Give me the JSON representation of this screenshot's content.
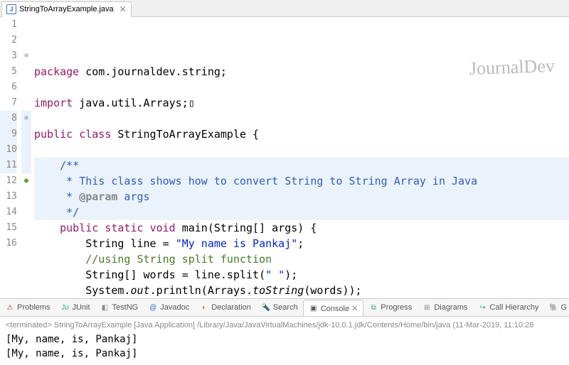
{
  "tab": {
    "filename": "StringToArrayExample.java",
    "icon_letter": "J"
  },
  "watermark": "JournalDev",
  "code": {
    "lines": [
      {
        "n": "1",
        "marker": "",
        "tokens": [
          [
            "kw",
            "package"
          ],
          [
            "plain",
            " com.journaldev.string;"
          ]
        ]
      },
      {
        "n": "2",
        "marker": "",
        "tokens": []
      },
      {
        "n": "3",
        "marker": "fold",
        "tokens": [
          [
            "kw",
            "import"
          ],
          [
            "plain",
            " java.util.Arrays;"
          ],
          [
            "plain",
            "▯"
          ]
        ]
      },
      {
        "n": "5",
        "marker": "",
        "tokens": []
      },
      {
        "n": "6",
        "marker": "",
        "tokens": [
          [
            "kw",
            "public"
          ],
          [
            "plain",
            " "
          ],
          [
            "kw",
            "class"
          ],
          [
            "plain",
            " StringToArrayExample {"
          ]
        ]
      },
      {
        "n": "7",
        "marker": "",
        "tokens": []
      },
      {
        "n": "8",
        "marker": "fold",
        "hl": true,
        "tokens": [
          [
            "plain",
            "    "
          ],
          [
            "jdoc",
            "/**"
          ]
        ]
      },
      {
        "n": "9",
        "marker": "",
        "hl": true,
        "tokens": [
          [
            "plain",
            "     "
          ],
          [
            "jdoc",
            "* This class shows how to convert String to String Array in Java"
          ]
        ]
      },
      {
        "n": "10",
        "marker": "",
        "hl": true,
        "tokens": [
          [
            "plain",
            "     "
          ],
          [
            "jdoc",
            "* "
          ],
          [
            "jdoc-tag",
            "@param"
          ],
          [
            "jdoc",
            " args"
          ]
        ]
      },
      {
        "n": "11",
        "marker": "",
        "hl": true,
        "tokens": [
          [
            "plain",
            "     "
          ],
          [
            "jdoc",
            "*/"
          ]
        ]
      },
      {
        "n": "12",
        "marker": "override",
        "tokens": [
          [
            "plain",
            "    "
          ],
          [
            "kw",
            "public"
          ],
          [
            "plain",
            " "
          ],
          [
            "kw",
            "static"
          ],
          [
            "plain",
            " "
          ],
          [
            "kw",
            "void"
          ],
          [
            "plain",
            " main(String[] args) {"
          ]
        ]
      },
      {
        "n": "13",
        "marker": "",
        "tokens": [
          [
            "plain",
            "        String line = "
          ],
          [
            "string",
            "\"My name is Pankaj\""
          ],
          [
            "plain",
            ";"
          ]
        ]
      },
      {
        "n": "14",
        "marker": "",
        "tokens": [
          [
            "plain",
            "        "
          ],
          [
            "comment",
            "//using String split function"
          ]
        ]
      },
      {
        "n": "15",
        "marker": "",
        "tokens": [
          [
            "plain",
            "        String[] words = line.split("
          ],
          [
            "string",
            "\" \""
          ],
          [
            "plain",
            ");"
          ]
        ]
      },
      {
        "n": "16",
        "marker": "",
        "tokens": [
          [
            "plain",
            "        System."
          ],
          [
            "static-it",
            "out"
          ],
          [
            "plain",
            ".println(Arrays."
          ],
          [
            "static-it",
            "toString"
          ],
          [
            "plain",
            "(words));"
          ]
        ]
      }
    ]
  },
  "views": [
    {
      "label": "Problems",
      "icon": "⚠",
      "color": "#a33"
    },
    {
      "label": "JUnit",
      "icon": "Jᴜ",
      "color": "#3a7"
    },
    {
      "label": "TestNG",
      "icon": "◧",
      "color": "#888"
    },
    {
      "label": "Javadoc",
      "icon": "@",
      "color": "#36c"
    },
    {
      "label": "Declaration",
      "icon": "◐",
      "color": "#c80"
    },
    {
      "label": "Search",
      "icon": "🔦",
      "color": "#c80"
    },
    {
      "label": "Console",
      "icon": "▣",
      "color": "#555",
      "active": true,
      "closable": true
    },
    {
      "label": "Progress",
      "icon": "⧉",
      "color": "#3a7"
    },
    {
      "label": "Diagrams",
      "icon": "⊞",
      "color": "#888"
    },
    {
      "label": "Call Hierarchy",
      "icon": "↪",
      "color": "#3a7"
    },
    {
      "label": "G",
      "icon": "🐘",
      "color": "#888"
    }
  ],
  "console": {
    "header_prefix": "<terminated>",
    "header_label": "StringToArrayExample [Java Application]",
    "header_path": "/Library/Java/JavaVirtualMachines/jdk-10.0.1.jdk/Contents/Home/bin/java",
    "header_timestamp": "(11-Mar-2019, 11:10:28",
    "output_lines": [
      "[My, name, is, Pankaj]",
      "[My, name, is, Pankaj]"
    ]
  }
}
